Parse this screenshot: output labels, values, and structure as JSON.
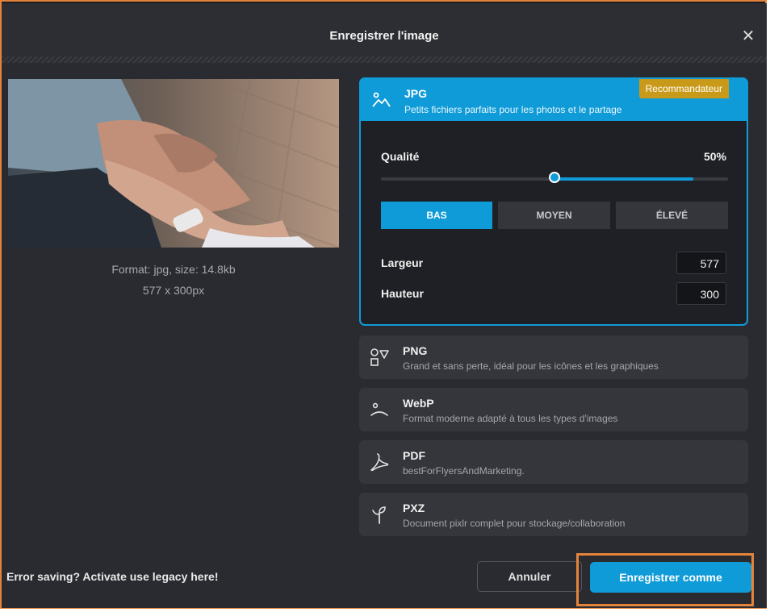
{
  "dialog": {
    "title": "Enregistrer l'image",
    "close_label": "✕"
  },
  "preview": {
    "format_line": "Format: jpg, size: 14.8kb",
    "dimensions_line": "577 x 300px"
  },
  "formats": [
    {
      "name": "JPG",
      "desc": "Petits fichiers parfaits pour les photos et le partage",
      "icon": "image-icon",
      "selected": true
    },
    {
      "name": "PNG",
      "desc": "Grand et sans perte, idéal pour les icônes et les graphiques",
      "icon": "shapes-icon"
    },
    {
      "name": "WebP",
      "desc": "Format moderne adapté à tous les types d'images",
      "icon": "webp-icon"
    },
    {
      "name": "PDF",
      "desc": "bestForFlyersAndMarketing.",
      "icon": "pdf-icon"
    },
    {
      "name": "PXZ",
      "desc": "Document pixlr complet pour stockage/collaboration",
      "icon": "sprout-icon"
    }
  ],
  "jpg_options": {
    "badge": "Recommandateur",
    "quality_label": "Qualité",
    "quality_value": "50%",
    "quality_fraction": 0.5,
    "quality_buttons": [
      "BAS",
      "MOYEN",
      "ÉLEVÉ"
    ],
    "active_quality": "BAS",
    "width_label": "Largeur",
    "width_value": "577",
    "height_label": "Hauteur",
    "height_value": "300"
  },
  "footer": {
    "legacy_text": "Error saving? Activate use legacy here!",
    "cancel_label": "Annuler",
    "save_label": "Enregistrer comme"
  },
  "colors": {
    "accent": "#0f9bd7",
    "badge": "#c99a1a",
    "highlight_frame": "#e4843a"
  }
}
